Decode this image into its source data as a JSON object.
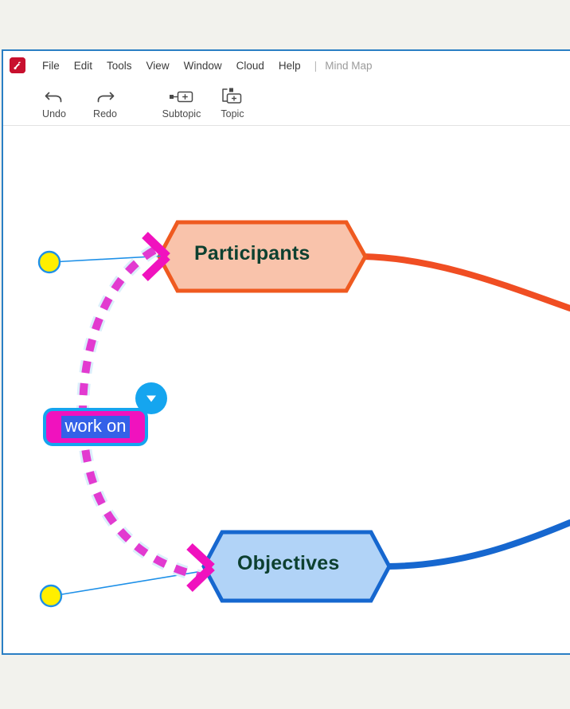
{
  "window": {
    "title": "Mind Map",
    "accent_border_color": "#2a7fc4",
    "background_color": "#ffffff",
    "desktop_background_color": "#f2f2ed"
  },
  "menu_bar": {
    "logo_icon": "app-logo-icon",
    "items": [
      {
        "label": "File"
      },
      {
        "label": "Edit"
      },
      {
        "label": "Tools"
      },
      {
        "label": "View"
      },
      {
        "label": "Window"
      },
      {
        "label": "Cloud"
      },
      {
        "label": "Help"
      }
    ],
    "separator": "|",
    "document_type": "Mind Map"
  },
  "toolbar": {
    "buttons": [
      {
        "label": "Undo",
        "icon": "undo-arrow-icon"
      },
      {
        "label": "Redo",
        "icon": "redo-arrow-icon"
      },
      {
        "label": "Subtopic",
        "icon": "subtopic-add-icon"
      },
      {
        "label": "Topic",
        "icon": "topic-add-icon"
      }
    ]
  },
  "canvas": {
    "nodes": [
      {
        "id": "participants",
        "text": "Participants",
        "shape": "hexagon",
        "fill_color": "#f9c3ab",
        "border_color": "#ef5a20",
        "text_color": "#0d4030",
        "branch_color": "#f04e23"
      },
      {
        "id": "objectives",
        "text": "Objectives",
        "shape": "hexagon",
        "fill_color": "#b1d3f7",
        "border_color": "#1667cf",
        "text_color": "#0d4030",
        "branch_color": "#1667cf"
      }
    ],
    "relationship": {
      "label": "work on",
      "line_color": "#e23ad0",
      "line_style": "dashed",
      "label_fill_color": "#f012be",
      "label_border_color": "#15a5ef",
      "label_text_color": "#ffffff",
      "label_text_highlight_color": "#3461e8",
      "arrow_color": "#f012be",
      "dropdown_badge_icon": "chevron-down-icon",
      "dropdown_badge_color": "#15a5ef"
    },
    "handles": [
      {
        "id": "handle-top",
        "icon": "drag-handle-icon",
        "fill_color": "#ffef00",
        "border_color": "#1e90e8"
      },
      {
        "id": "handle-bottom",
        "icon": "drag-handle-icon",
        "fill_color": "#ffef00",
        "border_color": "#1e90e8"
      }
    ],
    "handle_line_color": "#1e90e8"
  }
}
